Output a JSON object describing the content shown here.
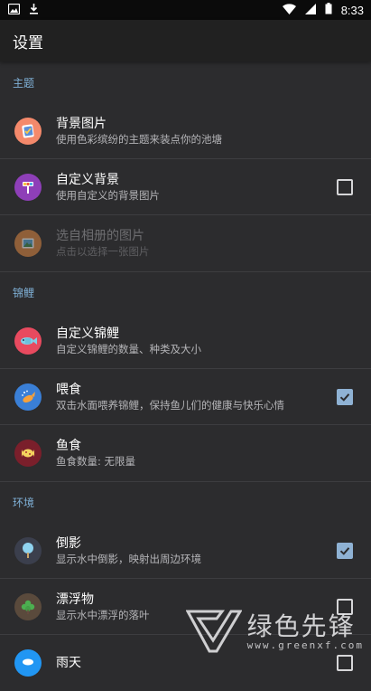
{
  "status_bar": {
    "time": "8:33"
  },
  "app_bar": {
    "title": "设置"
  },
  "sections": {
    "theme": {
      "header": "主题",
      "items": [
        {
          "title": "背景图片",
          "summary": "使用色彩缤纷的主题来装点你的池塘",
          "icon": "background-image-icon"
        },
        {
          "title": "自定义背景",
          "summary": "使用自定义的背景图片",
          "icon": "custom-background-icon",
          "checked": false
        },
        {
          "title": "选自相册的图片",
          "summary": "点击以选择一张图片",
          "icon": "gallery-image-icon",
          "disabled": true
        }
      ]
    },
    "koi": {
      "header": "锦鲤",
      "items": [
        {
          "title": "自定义锦鲤",
          "summary": "自定义锦鲤的数量、种类及大小",
          "icon": "koi-fish-icon"
        },
        {
          "title": "喂食",
          "summary": "双击水面喂养锦鲤，保持鱼儿们的健康与快乐心情",
          "icon": "feeding-icon",
          "checked": true
        },
        {
          "title": "鱼食",
          "summary": "鱼食数量: 无限量",
          "icon": "fish-food-icon"
        }
      ]
    },
    "environment": {
      "header": "环境",
      "items": [
        {
          "title": "倒影",
          "summary": "显示水中倒影，映射出周边环境",
          "icon": "reflection-tree-icon",
          "checked": true
        },
        {
          "title": "漂浮物",
          "summary": "显示水中漂浮的落叶",
          "icon": "floating-leaf-icon",
          "checked": false
        },
        {
          "title": "雨天",
          "icon": "rain-icon"
        }
      ]
    }
  },
  "watermark": {
    "brand": "绿色先锋",
    "url": "www.greenxf.com"
  },
  "colors": {
    "background": "#2c2c2e",
    "app_bar": "#212121",
    "status_bar": "#0b0b0b",
    "section_header": "#7fb0d6",
    "checkbox_checked": "#8fb2d4"
  }
}
